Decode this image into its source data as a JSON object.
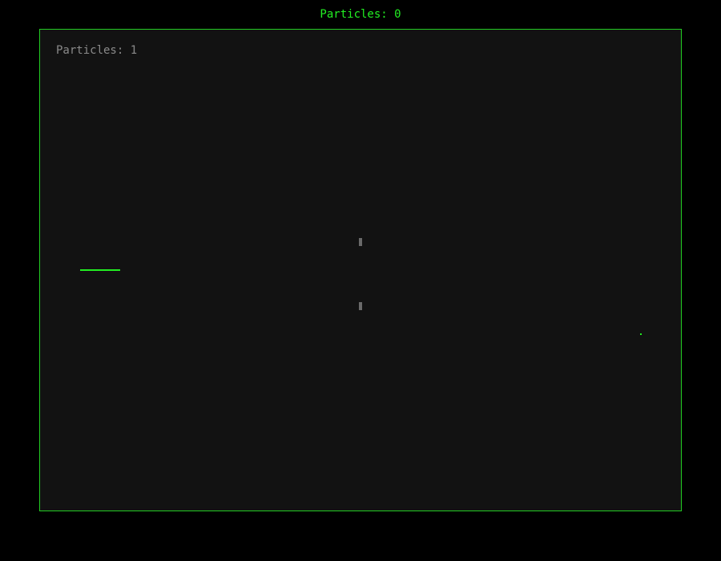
{
  "header": {
    "particle_counter": "Particles: 0"
  },
  "arena": {
    "particle_counter": "Particles: 1"
  },
  "colors": {
    "accent": "#22ee22",
    "border": "#22cc22",
    "arena_bg": "#121212",
    "page_bg": "#000000",
    "muted_text": "#8a8a8a",
    "marker": "#6a6a6a"
  }
}
